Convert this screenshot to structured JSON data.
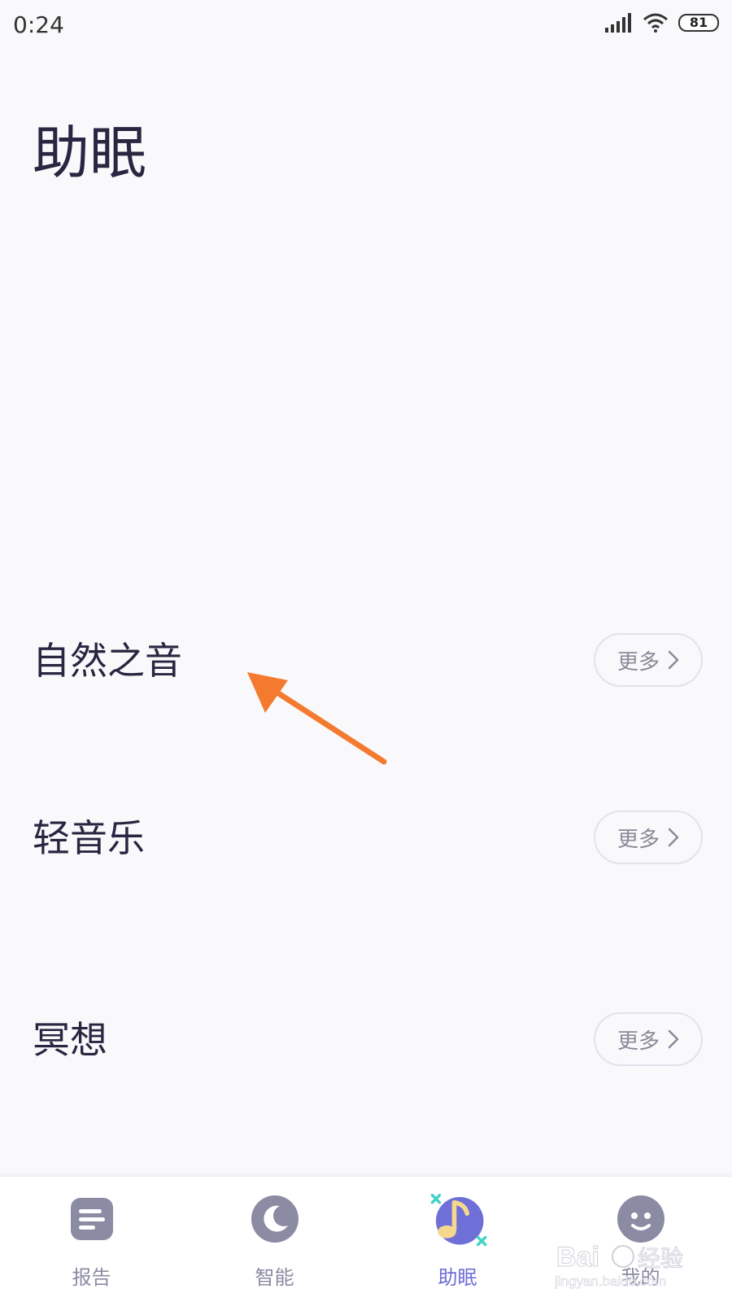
{
  "status_bar": {
    "time": "0:24",
    "battery": "81"
  },
  "page": {
    "title": "助眠"
  },
  "sections": [
    {
      "title": "自然之音",
      "more_label": "更多"
    },
    {
      "title": "轻音乐",
      "more_label": "更多"
    },
    {
      "title": "冥想",
      "more_label": "更多"
    }
  ],
  "bottom_nav": {
    "items": [
      {
        "label": "报告",
        "icon": "report-icon"
      },
      {
        "label": "智能",
        "icon": "moon-icon"
      },
      {
        "label": "助眠",
        "icon": "music-note-icon",
        "active": true
      },
      {
        "label": "我的",
        "icon": "profile-icon"
      }
    ]
  },
  "colors": {
    "accent": "#6f6fd8",
    "nav_inactive": "#8b8ba3",
    "arrow": "#f47a2f",
    "background": "#f9f9fc"
  },
  "watermark": {
    "text": "Bai 经验",
    "subtext": "jingyan.baidu.com"
  }
}
